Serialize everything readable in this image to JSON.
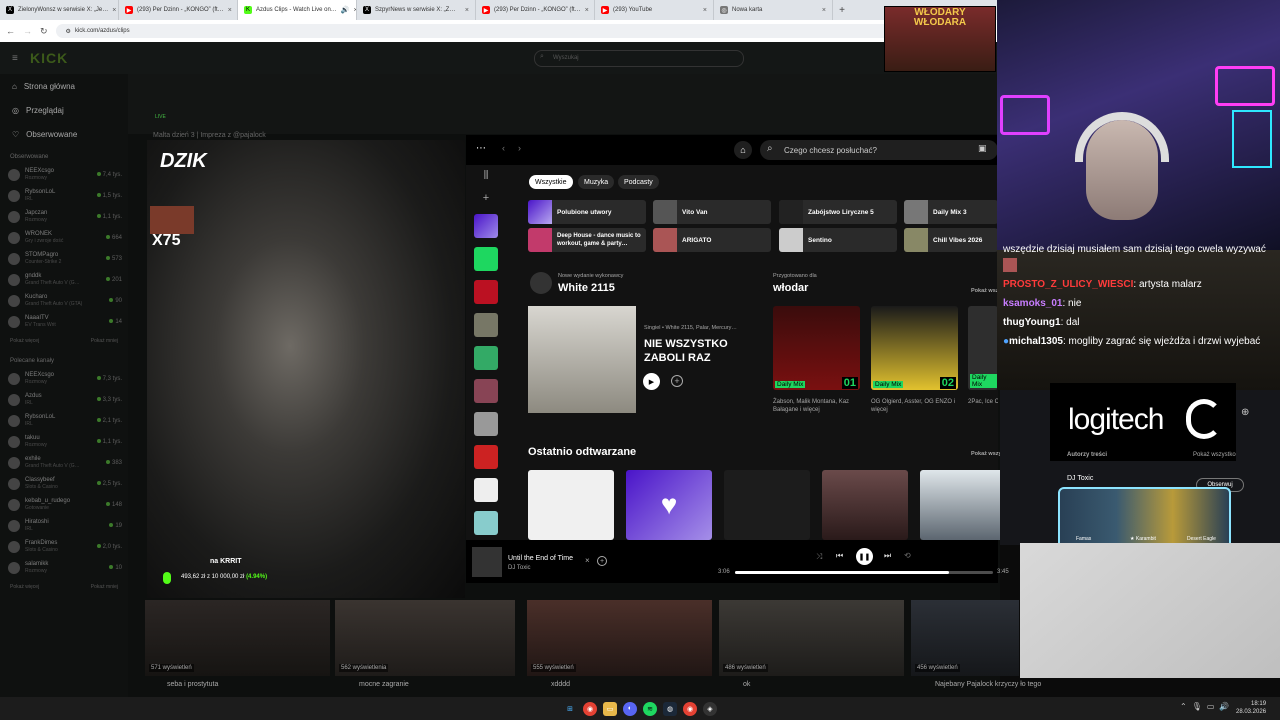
{
  "browser": {
    "tabs": [
      {
        "label": "ZielonyWonsz w serwisie X: „Je…",
        "icon": "x-logo-icon"
      },
      {
        "label": "(293) Per Dzinn - „KONGO” (ft…",
        "icon": "youtube-icon"
      },
      {
        "label": "Azdus Clips - Watch Live on…",
        "icon": "kick-icon"
      },
      {
        "label": "SzpyrNews w serwisie X: „Z…",
        "icon": "x-logo-icon"
      },
      {
        "label": "(293) Per Dzinn - „KONGO” (ft…",
        "icon": "youtube-icon"
      },
      {
        "label": "(293) YouTube",
        "icon": "youtube-icon"
      },
      {
        "label": "Nowa karta",
        "icon": "globe-icon"
      }
    ],
    "url": "kick.com/azdus/clips",
    "new_tab": "+"
  },
  "kick": {
    "logo": "KICK",
    "search_placeholder": "Wyszukaj",
    "nav": [
      "Strona główna",
      "Przeglądaj",
      "Obserwowane"
    ],
    "followed_header": "Obserwowane",
    "followed": [
      {
        "name": "NEEXcsgo",
        "game": "Rozmowy",
        "viewers": "7,4 tys."
      },
      {
        "name": "RybsonLoL",
        "game": "IRL",
        "viewers": "1,5 tys."
      },
      {
        "name": "Japczan",
        "game": "Rozmowy",
        "viewers": "1,1 tys."
      },
      {
        "name": "WRONEK",
        "game": "Gry i zwroje dość",
        "viewers": "664"
      },
      {
        "name": "STOMPagro",
        "game": "Counter-Strike 2",
        "viewers": "573"
      },
      {
        "name": "gnddk",
        "game": "Grand Theft Auto V (G…",
        "viewers": "201"
      },
      {
        "name": "Kucharo",
        "game": "Grand Theft Auto V (GTA)",
        "viewers": "90"
      },
      {
        "name": "NaaaITV",
        "game": "EV Trans Writ",
        "viewers": "14"
      }
    ],
    "show_more": "Pokaż więcej",
    "show_less": "Pokaż mniej",
    "recommended_header": "Polecane kanały",
    "recommended": [
      {
        "name": "NEEXcsgo",
        "game": "Rozmowy",
        "viewers": "7,3 tys."
      },
      {
        "name": "Azdus",
        "game": "IRL",
        "viewers": "3,3 tys."
      },
      {
        "name": "RybsonLoL",
        "game": "IRL",
        "viewers": "2,1 tys."
      },
      {
        "name": "takuu",
        "game": "Rozmowy",
        "viewers": "1,1 tys."
      },
      {
        "name": "exhile",
        "game": "Grand Theft Auto V (G…",
        "viewers": "383"
      },
      {
        "name": "Classybeef",
        "game": "Slots & Casino",
        "viewers": "2,5 tys."
      },
      {
        "name": "kebab_u_rudego",
        "game": "Gotowanie",
        "viewers": "148"
      },
      {
        "name": "Hiratoshi",
        "game": "IRL",
        "viewers": "19"
      },
      {
        "name": "FrankDimes",
        "game": "Slots & Casino",
        "viewers": "2,0 tys."
      },
      {
        "name": "salamikk",
        "game": "Rozmowy",
        "viewers": "10"
      }
    ],
    "video": {
      "live_badge": "LIVE",
      "title": "Malta dzień 3 | Impreza z @pajalock",
      "overlay_brand": "DZIK",
      "multiplier": "X75",
      "donor": "na KRRIT",
      "goal_text": "493,62 zł z 10 000,00 zł",
      "goal_pct": "(4.94%)"
    },
    "clips": [
      {
        "views": "571 wyświetleń",
        "title": "seba i prostytuta"
      },
      {
        "views": "562 wyświetlenia",
        "title": "mocne zagranie"
      },
      {
        "views": "555 wyświetleń",
        "title": "xdddd"
      },
      {
        "views": "486 wyświetleń",
        "title": "ok"
      },
      {
        "views": "456 wyświetleń",
        "title": "Najebany Pajalock krzyczy ło tego"
      }
    ]
  },
  "spotify": {
    "search_placeholder": "Czego chcesz posłuchać?",
    "chips": [
      "Wszystkie",
      "Muzyka",
      "Podcasty"
    ],
    "quick": [
      "Polubione utwory",
      "Vito Van",
      "Zabójstwo Liryczne 5",
      "Daily Mix 3",
      "Deep House - dance music to workout, game & party…",
      "ARIGATO",
      "Sentino",
      "Chill Vibes 2026"
    ],
    "new_release": {
      "label": "Nowe wydanie wykonawcy",
      "artist": "White 2115",
      "meta": "Singiel • White 2115, Palar, Mercury…",
      "title_line1": "NIE WSZYSTKO",
      "title_line2": "ZABOLI RAZ"
    },
    "for_user": {
      "label": "Przygotowano dla",
      "name": "włodar",
      "show_all": "Pokaż wszystko",
      "mixes": [
        {
          "label": "Daily Mix",
          "num": "01",
          "caption": "Żabson, Malik Montana, Kaz Bałagane i więcej",
          "color": "#7a1010"
        },
        {
          "label": "Daily Mix",
          "num": "02",
          "caption": "OG Olgierd, Asster, OG ENZO i więcej",
          "color": "#e2c22e"
        },
        {
          "label": "Daily Mix",
          "num": "04",
          "caption": "2Pac, Ice Cube, 50 Cent i więcej",
          "color": "#3a3a3a"
        }
      ]
    },
    "recent": {
      "title": "Ostatnio odtwarzane",
      "show_all": "Pokaż wszystko"
    },
    "player": {
      "track": "Until the End of Time",
      "artist": "DJ Toxic",
      "elapsed": "3:06",
      "total": "3:45",
      "progress": 0.83
    }
  },
  "stream_overlay": {
    "poster": "WŁODARY WŁODARA",
    "chat": [
      {
        "user": "",
        "msg": "wszędzie dzisiaj musiałem sam dzisiaj tego cwela wyzywać",
        "color": "#ffffff"
      },
      {
        "user": "PROSTO_Z_ULICY_WIESCI",
        "msg": ": artysta malarz",
        "color": "#ff3b3b"
      },
      {
        "user": "ksamoks_01",
        "msg": ": nie",
        "color": "#c87dff"
      },
      {
        "user": "thugYoung1",
        "msg": ": dal",
        "color": "#ffffff"
      },
      {
        "user": "michal1305",
        "msg": ": mogliby zagrać się wjeżdża i drzwi wyjebać",
        "color": "#ffffff"
      }
    ],
    "sponsor": "logitech",
    "right_panel_title": "Autorzy treści",
    "right_panel_show_all": "Pokaż wszystko",
    "right_panel_user": "DJ Toxic",
    "follow_btn": "Obserwuj",
    "knives": [
      "Famas",
      "★ Karambit",
      "Desert Eagle"
    ]
  },
  "taskbar": {
    "time": "18:19",
    "date": "28.03.2026"
  }
}
